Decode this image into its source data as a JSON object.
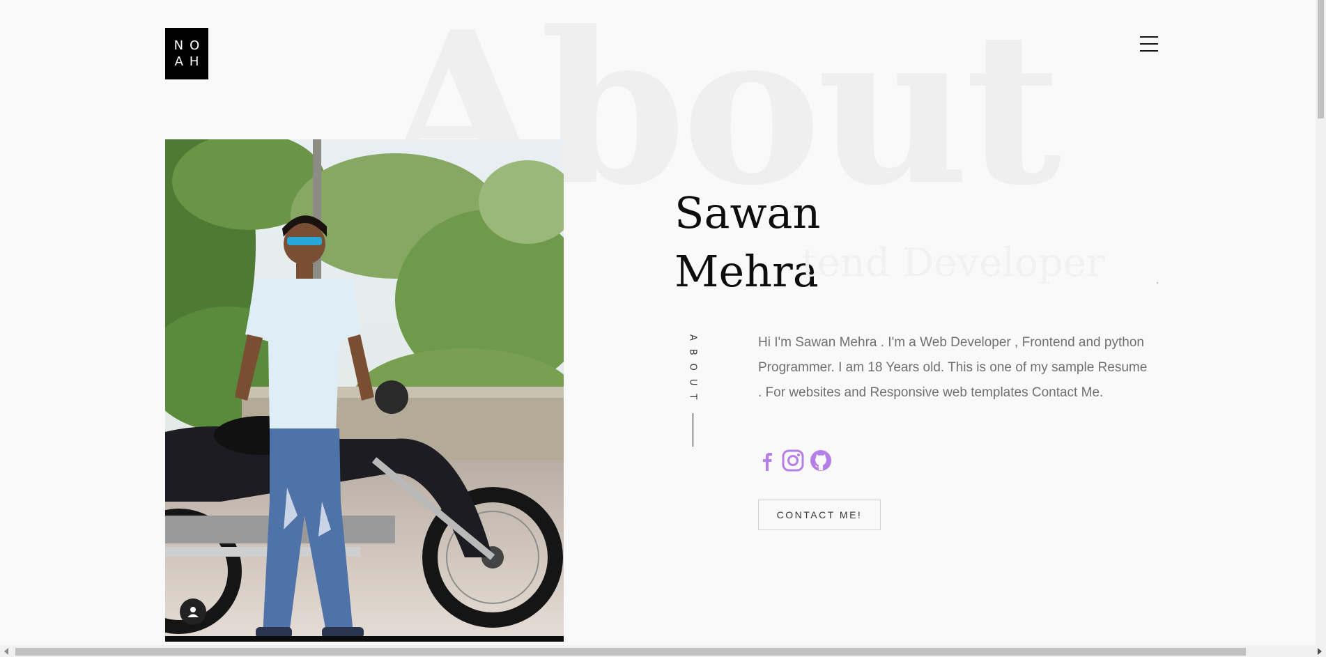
{
  "header": {
    "logo_line1": "NO",
    "logo_line2": "AH",
    "menu_icon": "hamburger-icon"
  },
  "hero": {
    "background_word": "About",
    "first_name": "Sawan",
    "last_name": "Mehra",
    "typed_role": "tend Developer",
    "photo_alt": "Sawan Mehra standing in front of a motorcycle"
  },
  "about": {
    "section_label": "ABOUT",
    "bio": "Hi I'm Sawan Mehra . I'm a Web Developer , Frontend and python Programmer. I am 18 Years old. This is one of my sample Resume . For websites and Responsive web templates Contact Me.",
    "socials": [
      {
        "icon": "facebook-icon"
      },
      {
        "icon": "instagram-icon"
      },
      {
        "icon": "github-icon"
      }
    ],
    "cta_label": "CONTACT ME!"
  },
  "colors": {
    "accent": "#b57ee8",
    "background": "#f9f9f9",
    "ghost_text": "#efefef"
  }
}
